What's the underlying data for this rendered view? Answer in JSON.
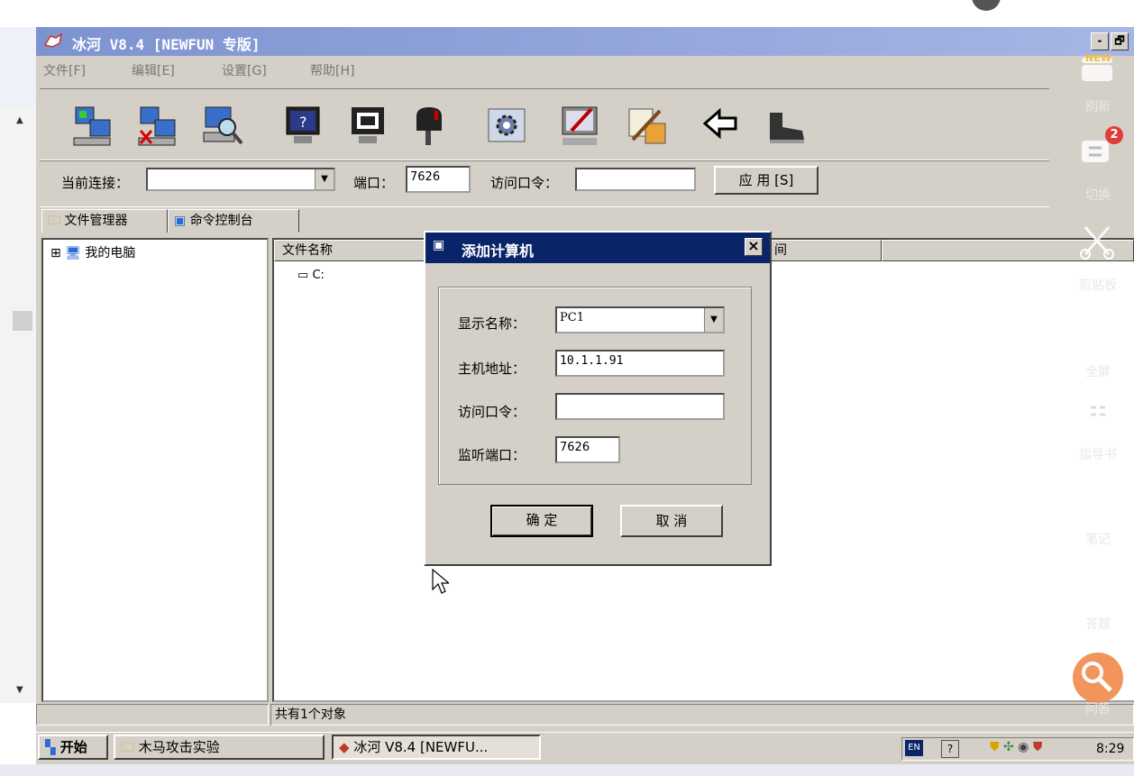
{
  "window": {
    "title": "冰河  V8.4 [NEWFUN 专版]",
    "minimize_glyph": "-",
    "restore_glyph": "🗗",
    "menu": [
      "文件[F]",
      "编辑[E]",
      "设置[G]",
      "帮助[H]"
    ]
  },
  "toolbar": {
    "icons": [
      "add-computer-icon",
      "delete-computer-icon",
      "search-computer-icon",
      "help-monitor-icon",
      "capture-screen-icon",
      "mailbox-icon",
      "settings-icon",
      "config-server-icon",
      "tools-icon",
      "back-arrow-icon",
      "exit-boot-icon"
    ]
  },
  "connection": {
    "current_label": "当前连接：",
    "current_value": "",
    "port_label": "端口：",
    "port_value": "7626",
    "password_label": "访问口令：",
    "password_value": "",
    "apply_label": "应 用 [S]"
  },
  "tabs": [
    {
      "label": "文件管理器",
      "icon": "folder-icon"
    },
    {
      "label": "命令控制台",
      "icon": "console-icon"
    }
  ],
  "tree": {
    "expander": "⊞",
    "root_label": "我的电脑"
  },
  "file_list": {
    "columns": [
      "文件名称",
      "间"
    ],
    "rows": [
      {
        "name": "C:",
        "icon": "drive-icon"
      }
    ]
  },
  "status": {
    "left": "",
    "count": "共有1个对象"
  },
  "taskbar": {
    "start_label": "开始",
    "items": [
      "木马攻击实验",
      "冰河  V8.4 [NEWFU..."
    ],
    "lang": "EN",
    "time": "8:29"
  },
  "dialog": {
    "title": "添加计算机",
    "close_glyph": "×",
    "fields": [
      {
        "label": "显示名称：",
        "value": "PC1"
      },
      {
        "label": "主机地址：",
        "value": "10.1.1.91"
      },
      {
        "label": "访问口令：",
        "value": ""
      },
      {
        "label": "监听端口：",
        "value": "7626"
      }
    ],
    "ok_label": "确 定",
    "cancel_label": "取 消"
  },
  "side_panel": {
    "new_badge": "NEW",
    "items": [
      {
        "label": "刷新",
        "icon": "refresh-icon"
      },
      {
        "label": "切换",
        "icon": "switch-icon",
        "badge": "2"
      },
      {
        "label": "剪贴板",
        "icon": "scissors-icon"
      },
      {
        "label": "全屏",
        "icon": "fullscreen-icon"
      },
      {
        "label": "指导书",
        "icon": "guide-book-icon"
      },
      {
        "label": "笔记",
        "icon": "pencil-icon"
      },
      {
        "label": "答题",
        "icon": "answer-icon"
      },
      {
        "label": "问答",
        "icon": "qa-icon"
      }
    ]
  },
  "colors": {
    "title_gradient_start": "#7d93d0",
    "dialog_title": "#0a246a",
    "window_face": "#d4d0c8",
    "badge_red": "#e23b3b",
    "qa_orange": "#f08a4b"
  }
}
